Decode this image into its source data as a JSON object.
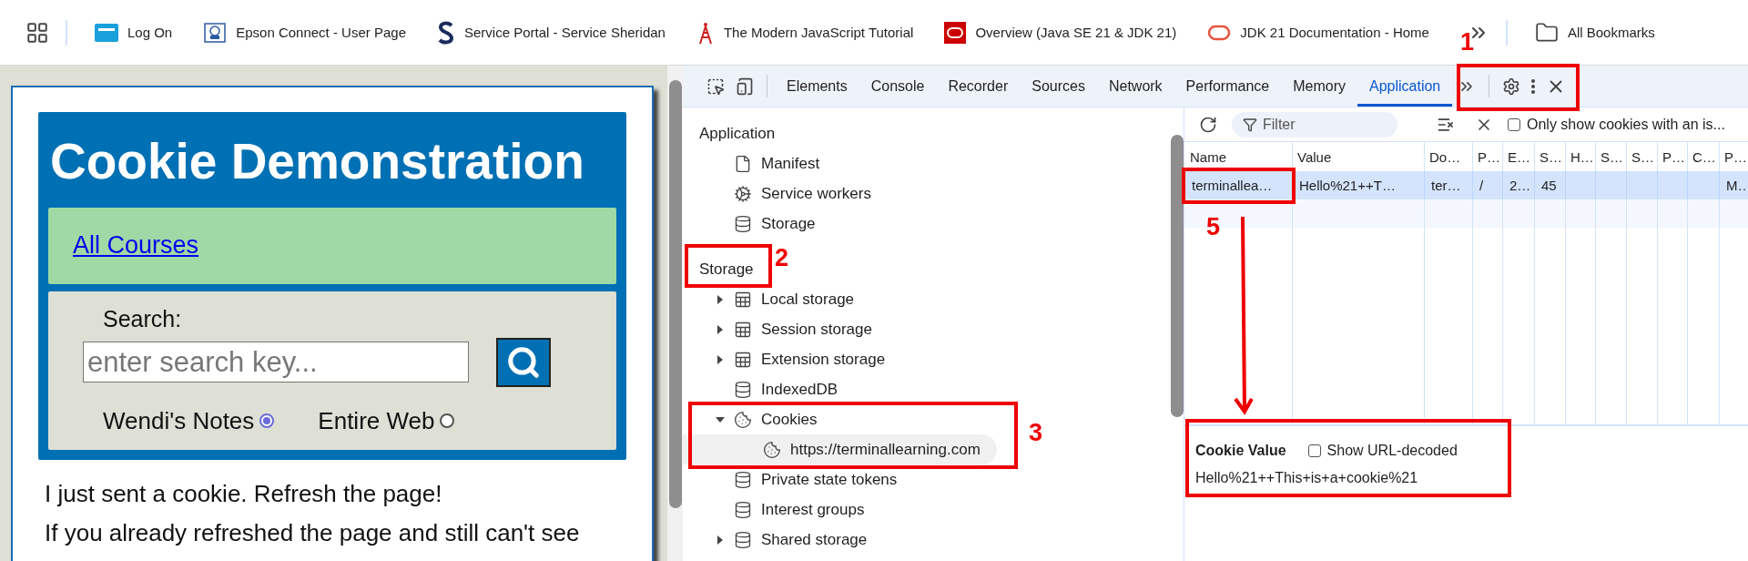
{
  "bookmarks_bar": {
    "items": [
      {
        "label": "Log On"
      },
      {
        "label": "Epson Connect - User Page"
      },
      {
        "label": "Service Portal - Service Sheridan"
      },
      {
        "label": "The Modern JavaScript Tutorial"
      },
      {
        "label": "Overview (Java SE 21 & JDK 21)"
      },
      {
        "label": "JDK 21 Documentation - Home"
      }
    ],
    "all_bookmarks": "All Bookmarks"
  },
  "page": {
    "title": "Cookie Demonstration",
    "nav_link": "All Courses",
    "search": {
      "label": "Search:",
      "placeholder": "enter search key..."
    },
    "scopes": [
      {
        "label": "Wendi's Notes",
        "selected": true
      },
      {
        "label": "Entire Web",
        "selected": false
      }
    ],
    "paragraphs": [
      "I just sent a cookie. Refresh the page!",
      "If you already refreshed the page and still can't see"
    ]
  },
  "devtools": {
    "tabs": [
      {
        "label": "Elements",
        "selected": false
      },
      {
        "label": "Console",
        "selected": false
      },
      {
        "label": "Recorder",
        "selected": false
      },
      {
        "label": "Sources",
        "selected": false
      },
      {
        "label": "Network",
        "selected": false
      },
      {
        "label": "Performance",
        "selected": false
      },
      {
        "label": "Memory",
        "selected": false
      },
      {
        "label": "Application",
        "selected": true
      }
    ],
    "sidebar": [
      {
        "title": "Application",
        "items": [
          {
            "label": "Manifest",
            "kind": "file"
          },
          {
            "label": "Service workers",
            "kind": "gears"
          },
          {
            "label": "Storage",
            "kind": "database"
          }
        ]
      },
      {
        "title": "Storage",
        "items": [
          {
            "label": "Local storage",
            "kind": "table",
            "expanded": false
          },
          {
            "label": "Session storage",
            "kind": "table",
            "expanded": false
          },
          {
            "label": "Extension storage",
            "kind": "table",
            "expanded": false
          },
          {
            "label": "IndexedDB",
            "kind": "database"
          },
          {
            "label": "Cookies",
            "kind": "cookie",
            "expanded": true,
            "children": [
              {
                "label": "https://terminallearning.com",
                "kind": "cookie",
                "selected": true
              }
            ]
          },
          {
            "label": "Private state tokens",
            "kind": "database"
          },
          {
            "label": "Interest groups",
            "kind": "database"
          },
          {
            "label": "Shared storage",
            "kind": "database",
            "expanded": false
          }
        ]
      }
    ],
    "cookies": {
      "filter_placeholder": "Filter",
      "only_issues": {
        "label": "Only show cookies with an is...",
        "checked": false
      },
      "columns": [
        "Name",
        "Value",
        "Do…",
        "P…",
        "E…",
        "S…",
        "H…",
        "S…",
        "S…",
        "P…",
        "C…",
        "P…"
      ],
      "rows": [
        {
          "selected": true,
          "cells": [
            "terminallea…",
            "Hello%21++T…",
            "ter…",
            "/",
            "2…",
            "45",
            "",
            "",
            "",
            "",
            "",
            "M…"
          ]
        }
      ],
      "value_panel": {
        "title": "Cookie Value",
        "show_decoded": {
          "label": "Show URL-decoded",
          "checked": false
        },
        "value": "Hello%21++This+is+a+cookie%21"
      }
    }
  },
  "annotations": [
    {
      "label": "1"
    },
    {
      "label": "2"
    },
    {
      "label": "3"
    },
    {
      "label": "5"
    }
  ]
}
